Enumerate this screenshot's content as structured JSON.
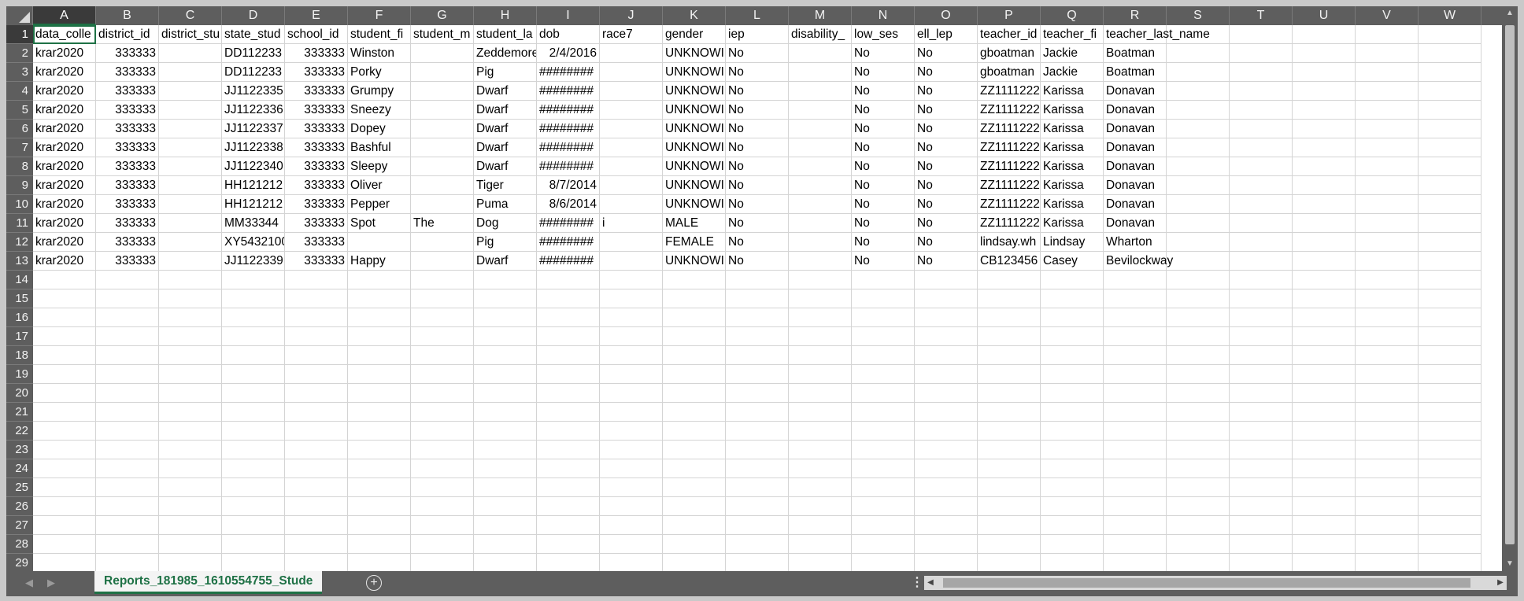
{
  "columns": [
    "A",
    "B",
    "C",
    "D",
    "E",
    "F",
    "G",
    "H",
    "I",
    "J",
    "K",
    "L",
    "M",
    "N",
    "O",
    "P",
    "Q",
    "R",
    "S",
    "T",
    "U",
    "V",
    "W"
  ],
  "row_numbers": [
    "1",
    "2",
    "3",
    "4",
    "5",
    "6",
    "7",
    "8",
    "9",
    "10",
    "11",
    "12",
    "13",
    "14",
    "15",
    "16",
    "17",
    "18",
    "19",
    "20",
    "21",
    "22",
    "23",
    "24",
    "25",
    "26",
    "27",
    "28",
    "29"
  ],
  "rows": [
    [
      "data_colle",
      "district_id",
      "district_stu",
      "state_stud",
      "school_id",
      "student_fi",
      "student_m",
      "student_la",
      "dob",
      "race7",
      "gender",
      "iep",
      "disability_",
      "low_ses",
      "ell_lep",
      "teacher_id",
      "teacher_fi",
      "teacher_last_name"
    ],
    [
      "krar2020",
      "333333",
      "",
      "DD112233",
      "333333",
      "Winston",
      "",
      "Zeddemore",
      "2/4/2016",
      "",
      "UNKNOWI",
      "No",
      "",
      "No",
      "No",
      "gboatman",
      "Jackie",
      "Boatman"
    ],
    [
      "krar2020",
      "333333",
      "",
      "DD112233",
      "333333",
      "Porky",
      "",
      "Pig",
      "########",
      "",
      "UNKNOWI",
      "No",
      "",
      "No",
      "No",
      "gboatman",
      "Jackie",
      "Boatman"
    ],
    [
      "krar2020",
      "333333",
      "",
      "JJ1122335",
      "333333",
      "Grumpy",
      "",
      "Dwarf",
      "########",
      "",
      "UNKNOWI",
      "No",
      "",
      "No",
      "No",
      "ZZ1111222",
      "Karissa",
      "Donavan"
    ],
    [
      "krar2020",
      "333333",
      "",
      "JJ1122336",
      "333333",
      "Sneezy",
      "",
      "Dwarf",
      "########",
      "",
      "UNKNOWI",
      "No",
      "",
      "No",
      "No",
      "ZZ1111222",
      "Karissa",
      "Donavan"
    ],
    [
      "krar2020",
      "333333",
      "",
      "JJ1122337",
      "333333",
      "Dopey",
      "",
      "Dwarf",
      "########",
      "",
      "UNKNOWI",
      "No",
      "",
      "No",
      "No",
      "ZZ1111222",
      "Karissa",
      "Donavan"
    ],
    [
      "krar2020",
      "333333",
      "",
      "JJ1122338",
      "333333",
      "Bashful",
      "",
      "Dwarf",
      "########",
      "",
      "UNKNOWI",
      "No",
      "",
      "No",
      "No",
      "ZZ1111222",
      "Karissa",
      "Donavan"
    ],
    [
      "krar2020",
      "333333",
      "",
      "JJ1122340",
      "333333",
      "Sleepy",
      "",
      "Dwarf",
      "########",
      "",
      "UNKNOWI",
      "No",
      "",
      "No",
      "No",
      "ZZ1111222",
      "Karissa",
      "Donavan"
    ],
    [
      "krar2020",
      "333333",
      "",
      "HH121212",
      "333333",
      "Oliver",
      "",
      "Tiger",
      "8/7/2014",
      "",
      "UNKNOWI",
      "No",
      "",
      "No",
      "No",
      "ZZ1111222",
      "Karissa",
      "Donavan"
    ],
    [
      "krar2020",
      "333333",
      "",
      "HH121212",
      "333333",
      "Pepper",
      "",
      "Puma",
      "8/6/2014",
      "",
      "UNKNOWI",
      "No",
      "",
      "No",
      "No",
      "ZZ1111222",
      "Karissa",
      "Donavan"
    ],
    [
      "krar2020",
      "333333",
      "",
      "MM33344",
      "333333",
      "Spot",
      "The",
      "Dog",
      "########",
      "i",
      "MALE",
      "No",
      "",
      "No",
      "No",
      "ZZ1111222",
      "Karissa",
      "Donavan"
    ],
    [
      "krar2020",
      "333333",
      "",
      "XY5432100",
      "333333",
      "",
      "",
      "Pig",
      "########",
      "",
      "FEMALE",
      "No",
      "",
      "No",
      "No",
      "lindsay.wh",
      "Lindsay",
      "Wharton"
    ],
    [
      "krar2020",
      "333333",
      "",
      "JJ1122339",
      "333333",
      "Happy",
      "",
      "Dwarf",
      "########",
      "",
      "UNKNOWI",
      "No",
      "",
      "No",
      "No",
      "CB123456",
      "Casey",
      "Bevilockway"
    ]
  ],
  "sheet_tab": "Reports_181985_1610554755_Stude",
  "icons": {
    "add_sheet": "plus-circle-icon",
    "options": "vertical-dots-icon"
  }
}
